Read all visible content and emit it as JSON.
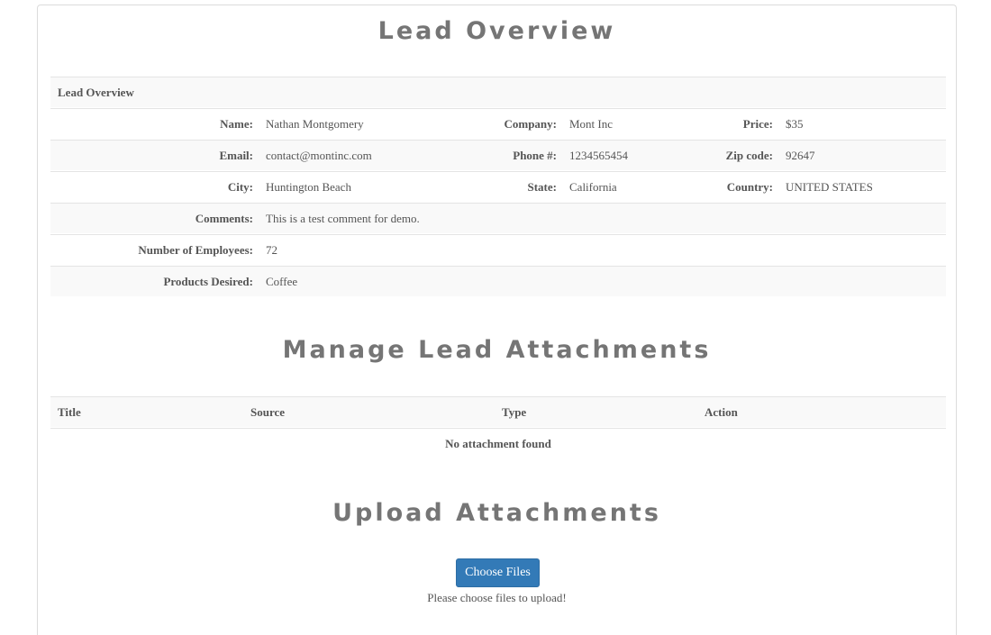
{
  "page": {
    "title": "Lead Overview",
    "accent_color": "#337ab7"
  },
  "overview_table": {
    "header": "Lead Overview",
    "rows": [
      [
        {
          "label": "Name:",
          "value": "Nathan Montgomery"
        },
        {
          "label": "Company:",
          "value": "Mont Inc"
        },
        {
          "label": "Price:",
          "value": "$35"
        }
      ],
      [
        {
          "label": "Email:",
          "value": "contact@montinc.com"
        },
        {
          "label": "Phone #:",
          "value": "1234565454"
        },
        {
          "label": "Zip code:",
          "value": "92647"
        }
      ],
      [
        {
          "label": "City:",
          "value": "Huntington Beach"
        },
        {
          "label": "State:",
          "value": "California"
        },
        {
          "label": "Country:",
          "value": "UNITED STATES"
        }
      ],
      [
        {
          "label": "Comments:",
          "value": "This is a test comment for demo."
        }
      ],
      [
        {
          "label": "Number of Employees:",
          "value": "72"
        }
      ],
      [
        {
          "label": "Products Desired:",
          "value": "Coffee"
        }
      ]
    ]
  },
  "attachments": {
    "title": "Manage Lead Attachments",
    "columns": [
      "Title",
      "Source",
      "Type",
      "Action"
    ],
    "empty_message": "No attachment found"
  },
  "upload": {
    "title": "Upload Attachments",
    "button_label": "Choose Files",
    "hint": "Please choose files to upload!"
  }
}
